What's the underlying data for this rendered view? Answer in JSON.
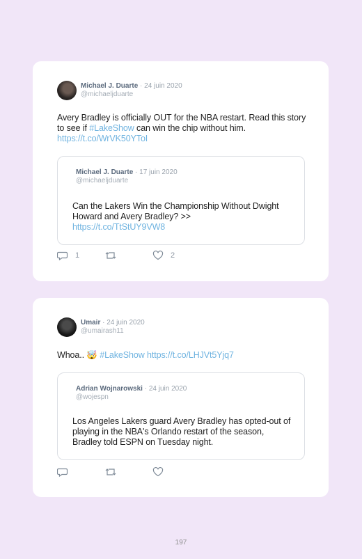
{
  "tweets": [
    {
      "author_name": "Michael J. Duarte",
      "date": "· 24 juin 2020",
      "handle": "@michaeljduarte",
      "text_before": "Avery Bradley is officially OUT for the NBA restart. Read this story to see if ",
      "hashtag": "#LakeShow",
      "text_after": " can win the chip without him.",
      "link": "https://t.co/WrVK50YToI",
      "quoted": {
        "author_name": "Michael J. Duarte",
        "date": "· 17 juin 2020",
        "handle": "@michaeljduarte",
        "text": "Can the Lakers Win the Championship Without Dwight Howard and Avery Bradley? >>",
        "link": "https://t.co/TtStUY9VW8"
      },
      "reply_count": "1",
      "retweet_count": "",
      "like_count": "2"
    },
    {
      "author_name": "Umair",
      "date": "· 24 juin 2020",
      "handle": "@umairash11",
      "text_before": "Whoa.. ",
      "emoji": "🤯",
      "hashtag": "#LakeShow",
      "link": "https://t.co/LHJVt5Yjq7",
      "quoted": {
        "author_name": "Adrian Wojnarowski",
        "date": "· 24 juin 2020",
        "handle": "@wojespn",
        "text": "Los Angeles Lakers guard Avery Bradley has opted-out of playing in the NBA's Orlando restart of the season, Bradley told ESPN on Tuesday night."
      },
      "reply_count": "",
      "retweet_count": "",
      "like_count": ""
    }
  ],
  "page_number": "197",
  "icons": [
    "reply-icon",
    "retweet-icon",
    "like-icon"
  ],
  "colors": {
    "background": "#f1e6f8",
    "link": "#6fb3e0",
    "name": "#5b6a7d"
  }
}
